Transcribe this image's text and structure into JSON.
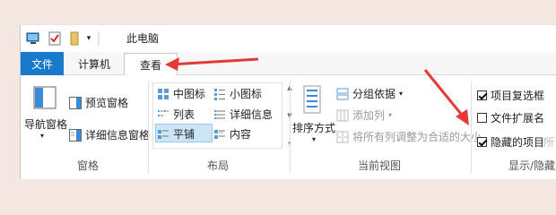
{
  "window": {
    "title": "此电脑"
  },
  "tabs": {
    "file": "文件",
    "computer": "计算机",
    "view": "查看"
  },
  "panes": {
    "nav_pane": "导航窗格",
    "preview_pane": "预览窗格",
    "details_pane": "详细信息窗格",
    "group_label": "窗格"
  },
  "layout": {
    "medium_icons": "中图标",
    "small_icons": "小图标",
    "list": "列表",
    "details": "详细信息",
    "tiles": "平铺",
    "content": "内容",
    "group_label": "布局"
  },
  "current_view": {
    "sort_by": "排序方式",
    "group_by": "分组依据",
    "add_columns": "添加列",
    "size_all_columns": "将所有列调整为合适的大小",
    "group_label": "当前视图"
  },
  "show_hide": {
    "item_checkboxes": "项目复选框",
    "file_extensions": "文件扩展名",
    "hidden_items": "隐藏的项目",
    "item_checkboxes_checked": true,
    "file_extensions_checked": false,
    "hidden_items_checked": true,
    "truncated_label": "所",
    "group_label": "显示/隐藏"
  },
  "icons": [
    "computer-icon",
    "properties-icon",
    "folder-icon",
    "dropdown-icon",
    "pane-icon",
    "view-icon",
    "sort-icon",
    "checkbox-icon"
  ],
  "colors": {
    "file_tab": "#1979ca",
    "arrow": "#e53935",
    "selection": "#cde6f7",
    "background": "#f4e7e2"
  }
}
